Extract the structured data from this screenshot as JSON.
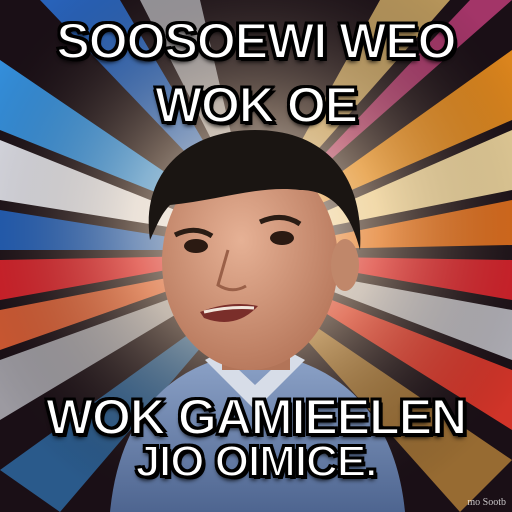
{
  "meme": {
    "top_line_1": "SOOSOEWI  WEO",
    "top_line_2": "WOK OE",
    "bottom_line_1": "WOK GAMIEELEN",
    "bottom_line_2": "JIO  OIMICE.",
    "watermark": "mo Sootb"
  },
  "colors": {
    "ray_blue": "#3aa6ff",
    "ray_red": "#e8202a",
    "ray_orange": "#ff9a1e",
    "ray_white": "#f4f6ff",
    "shirt": "#6b86b3",
    "hair": "#1a1512",
    "skin": "#d39a7c"
  }
}
